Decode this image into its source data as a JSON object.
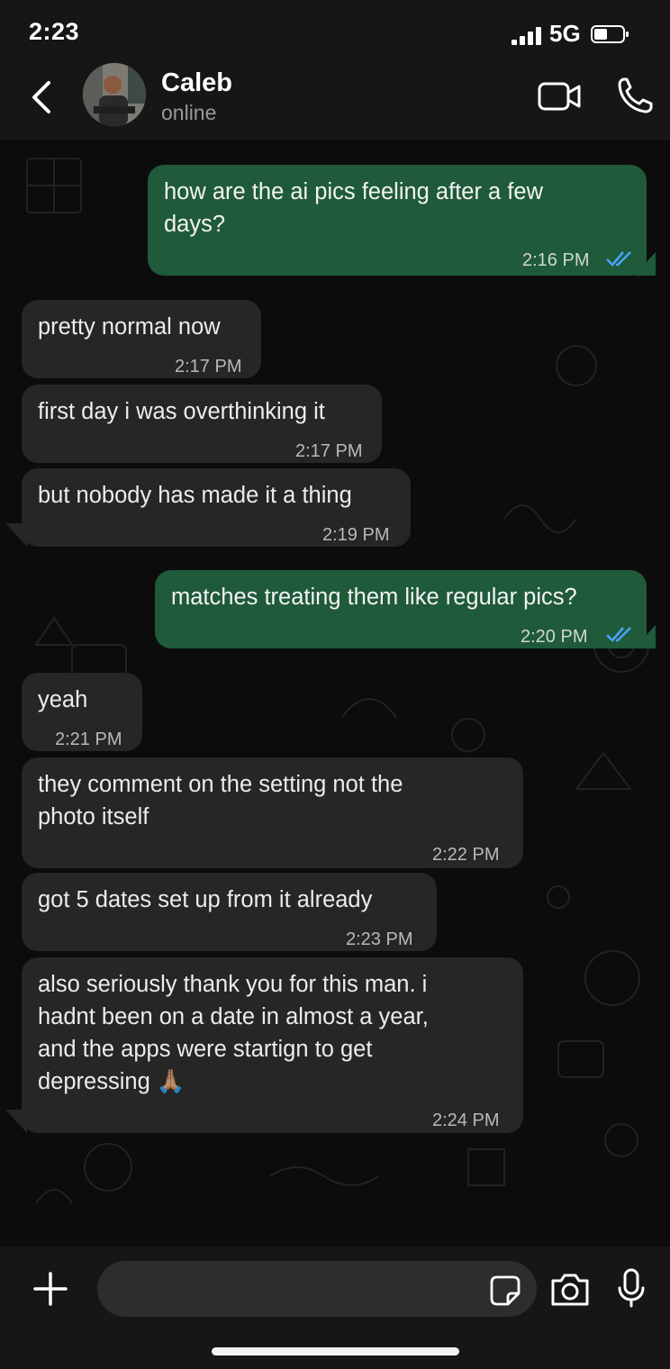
{
  "status_bar": {
    "time": "2:23",
    "network": "5G"
  },
  "header": {
    "contact_name": "Caleb",
    "contact_status": "online",
    "icons": [
      "chevron-left-icon",
      "avatar",
      "video-camera-icon",
      "phone-icon"
    ]
  },
  "messages": [
    {
      "direction": "out",
      "text": "how are the ai pics feeling after a few\ndays?",
      "time": "2:16 PM",
      "read": true
    },
    {
      "direction": "in",
      "text": "pretty normal now",
      "time": "2:17 PM"
    },
    {
      "direction": "in",
      "text": "first day i was overthinking it",
      "time": "2:17 PM"
    },
    {
      "direction": "in",
      "text": "but nobody has made it a thing",
      "time": "2:19 PM"
    },
    {
      "direction": "out",
      "text": "matches treating them like regular pics?",
      "time": "2:20 PM",
      "read": true
    },
    {
      "direction": "in",
      "text": "yeah",
      "time": "2:21 PM"
    },
    {
      "direction": "in",
      "text": "they comment on the setting not the\nphoto itself",
      "time": "2:22 PM"
    },
    {
      "direction": "in",
      "text": "got 5 dates set up from it already",
      "time": "2:23 PM"
    },
    {
      "direction": "in",
      "text": "also seriously thank you for this man. i\nhadnt been on a date in almost a year,\nand the apps were startign to get\ndepressing 🙏🏽",
      "time": "2:24 PM"
    }
  ],
  "input_bar": {
    "message_value": "",
    "icons": [
      "plus-icon",
      "sticker-icon",
      "camera-icon",
      "microphone-icon"
    ]
  },
  "colors": {
    "outgoing_bubble": "#1f5a3a",
    "incoming_bubble": "#262626",
    "read_ticks": "#4aa3ff",
    "background": "#0c0c0c"
  }
}
